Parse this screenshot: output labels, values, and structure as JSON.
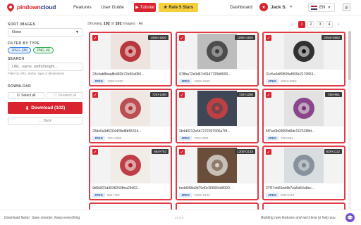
{
  "header": {
    "logo_a": "pindown",
    "logo_b": "cloud",
    "nav": [
      "Features",
      "User Guide"
    ],
    "tutorial_label": "Tutorial",
    "rate_label": "Rate 5 Stars",
    "dashboard_label": "Dashboard",
    "user_name": "Jack S.",
    "language": "EN"
  },
  "sidebar": {
    "sort_title": "SORT IMAGES",
    "sort_value": "None",
    "filter_title": "FILTER BY TYPE",
    "tag_jpeg": "JPEG (98)",
    "tag_png": "PNG (4)",
    "search_title": "SEARCH",
    "search_placeholder": "URL, name, width/height...",
    "search_hint": "Filter by URL, name, type or dimensions",
    "download_title": "DOWNLOAD",
    "select_all": "Select all",
    "deselect_all": "Deselect all",
    "download_label": "Download (102)",
    "back_label": "Back"
  },
  "main": {
    "showing_prefix": "Showing",
    "shown": "102",
    "of": "of",
    "total": "102",
    "images_word": "images",
    "filter_label": "All",
    "pages": [
      "1",
      "2",
      "3",
      "4"
    ]
  },
  "cards": [
    {
      "dims": "1080×1920",
      "name": "23c4ab8baa8b482b72e50a055...",
      "format": "JPEG",
      "res": "1080×1920",
      "swatch": "#ede4df",
      "accent": "#b01822"
    },
    {
      "dims": "1080×1920",
      "name": "978ba72e0d67c6947720b8000...",
      "format": "JPEG",
      "res": "1080×1920",
      "swatch": "#bdbdbd",
      "accent": "#3a3a3a"
    },
    {
      "dims": "2054×3652",
      "name": "31c5e6d89509ef009c2170551...",
      "format": "JPEG",
      "res": "2054×3652",
      "swatch": "#e8e8e8",
      "accent": "#111111"
    },
    {
      "dims": "720×1280",
      "name": "23de0a3d52044f3bd8b55316...",
      "format": "JPEG",
      "res": "720×1280",
      "swatch": "#f0e8e2",
      "accent": "#b2323a"
    },
    {
      "dims": "720×1280",
      "name": "2b4d0212e5b7272037906a70f...",
      "format": "JPEG",
      "res": "720×1280",
      "swatch": "#3f4757",
      "accent": "#d64040"
    },
    {
      "dims": "736×981",
      "name": "5f7ac0b09059d0dc1675288d...",
      "format": "JPEG",
      "res": "736×981",
      "swatch": "#e2e2e2",
      "accent": "#7a2a7a"
    },
    {
      "dims": "564×752",
      "name": "9d6b821d4038243ffea29462...",
      "format": "JPEG",
      "res": "564×752",
      "swatch": "#f1ece6",
      "accent": "#b5202c"
    },
    {
      "dims": "1200×2133",
      "name": "bcdd098a9d79d0c366654d9090...",
      "format": "JPEG",
      "res": "1200×2133",
      "swatch": "#6a4e3a",
      "accent": "#d8d4cc"
    },
    {
      "dims": "828×1112",
      "name": "37f17cb66ed4b7ea0a54a8ec...",
      "format": "JPEG",
      "res": "828×1112",
      "swatch": "#d8dde0",
      "accent": "#7a8590"
    }
  ],
  "footer": {
    "left": "Download faster. Save smarter. Keep everything.",
    "version": "v1.0.0",
    "right": "Building new features and we'd love to help you."
  },
  "colors": {
    "brand_red": "#d9242f",
    "brand_blue": "#2c3e8f",
    "rate_yellow": "#f6cf3a",
    "chat_purple": "#7b4de0"
  }
}
